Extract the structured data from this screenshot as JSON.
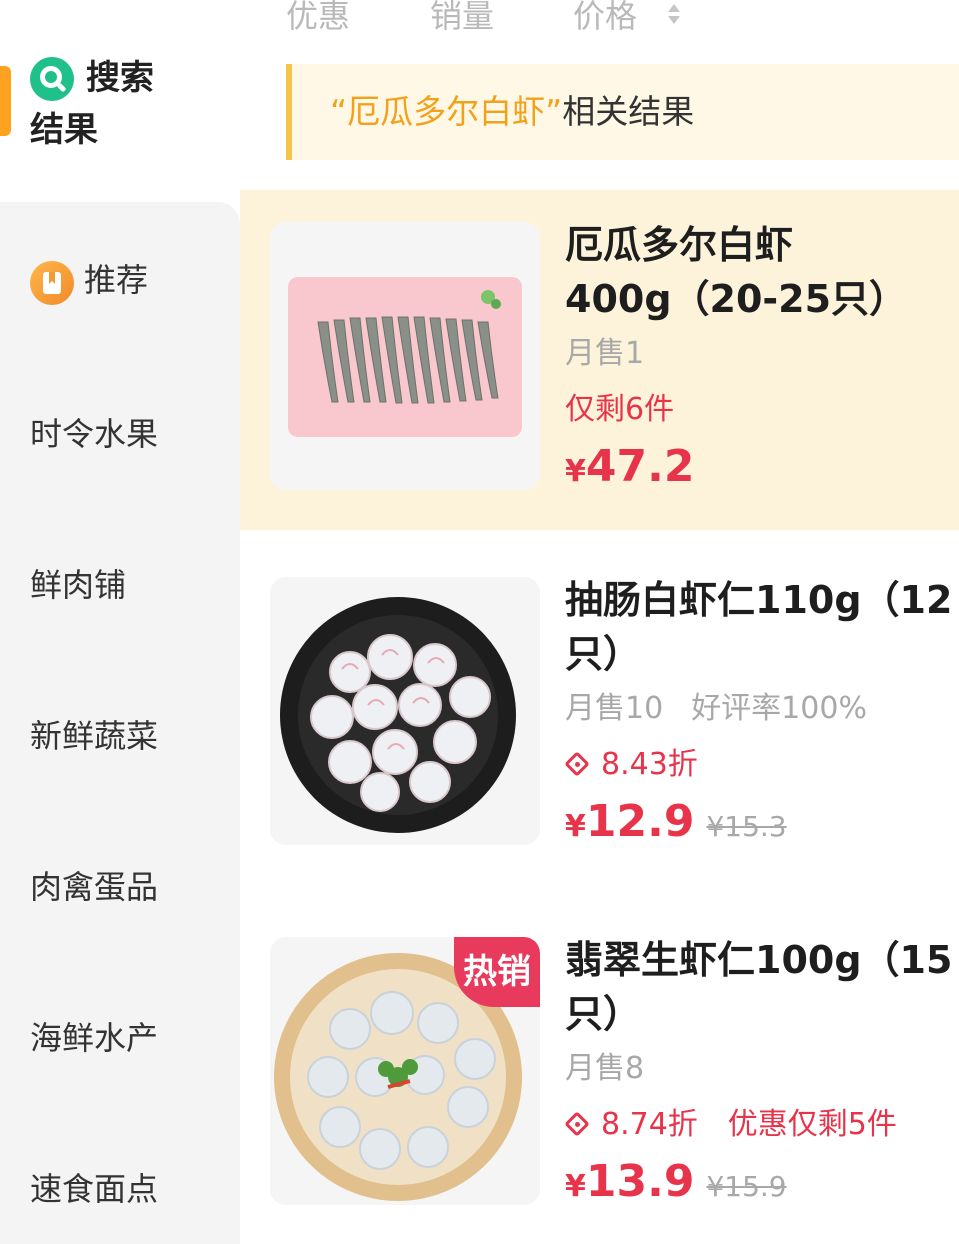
{
  "sort_bar": {
    "items": [
      "优惠",
      "销量",
      "价格"
    ]
  },
  "sidebar": {
    "active_label": "搜索结果",
    "items": [
      "推荐",
      "时令水果",
      "鲜肉铺",
      "新鲜蔬菜",
      "肉禽蛋品",
      "海鲜水产",
      "速食面点"
    ]
  },
  "banner": {
    "keyword": "“厄瓜多尔白虾”",
    "suffix": "相关结果"
  },
  "products": [
    {
      "title_line1": "厄瓜多尔白虾",
      "title_line2": "400g（20-25只）",
      "sales": "月售1",
      "rating": "",
      "promo": "仅剩6件",
      "discount": "",
      "currency": "¥",
      "price": "47.2",
      "original_price": "",
      "badge": ""
    },
    {
      "title_line1": "抽肠白虾仁110g（12",
      "title_line2": "只）",
      "sales": "月售10",
      "rating": "好评率100%",
      "promo": "",
      "discount": "8.43折",
      "currency": "¥",
      "price": "12.9",
      "original_price": "¥15.3",
      "badge": ""
    },
    {
      "title_line1": "翡翠生虾仁100g（15",
      "title_line2": "只）",
      "sales": "月售8",
      "rating": "",
      "promo": "优惠仅剩5件",
      "discount": "8.74折",
      "currency": "¥",
      "price": "13.9",
      "original_price": "¥15.9",
      "badge": "热销"
    }
  ],
  "colors": {
    "accent": "#ffa21f",
    "price": "#e8344a",
    "keyword": "#f2a21a",
    "search_icon": "#20c08a"
  }
}
